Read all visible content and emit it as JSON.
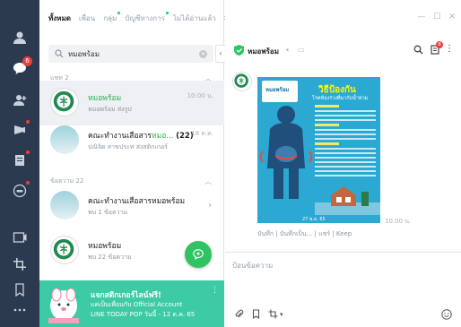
{
  "tabs": [
    {
      "label": "ทั้งหมด",
      "active": true
    },
    {
      "label": "เพื่อน"
    },
    {
      "label": "กลุ่ม",
      "dot": true
    },
    {
      "label": "บัญชีทางการ",
      "dot": true
    },
    {
      "label": "ไม่ได้อ่านแล้ว"
    }
  ],
  "rail": {
    "chats_badge": "6"
  },
  "search": {
    "value": "หมอพร้อม"
  },
  "sections": {
    "first": "แชท 2",
    "second": "ข้อความ 22"
  },
  "chats": [
    {
      "name": "หมอพร้อม",
      "sub": "หมอพร้อม ส่งรูป",
      "time": "10:00 น."
    },
    {
      "name_pre": "คณะทำงานเสือสาร",
      "name_hl": "หมอ...",
      "count": "(22)",
      "sub": "ปณิจิต สาขประท ส่งสติกเกอร์",
      "time": "18 ต.ค."
    }
  ],
  "messages": [
    {
      "name": "คณะทำงานเสือสารหมอพร้อม",
      "sub": "พบ 1 ข้อความ"
    },
    {
      "name": "หมอพร้อม",
      "sub": "พบ 22 ข้อความ"
    }
  ],
  "promo": {
    "line1": "แจกสติกเกอร์ไลน์ฟรี!",
    "line2": "แค่เป็นเพื่อนกับ Official Account",
    "line3": "LINE TODAY POP วันนี้ - 12 ต.ค. 65"
  },
  "chat": {
    "title": "หมอพร้อม",
    "notes_badge": "8",
    "poster_logo": "หมอพร้อม",
    "poster_title": "วิธีป้องกัน",
    "poster_sub": "โรคท้องร่วงที่มากับน้ำท่วม",
    "poster_date": "27 พ.ค. 65",
    "time": "10.00 น.",
    "actions": "บันทึก | บันทึกเป็น... | แชร์ | Keep",
    "input_placeholder": "ป้อนข้อความ"
  },
  "colors": {
    "rail": "#2c3a4f",
    "accent": "#2fc363",
    "promo": "#3ccba4",
    "badge": "#ee3d3d"
  }
}
